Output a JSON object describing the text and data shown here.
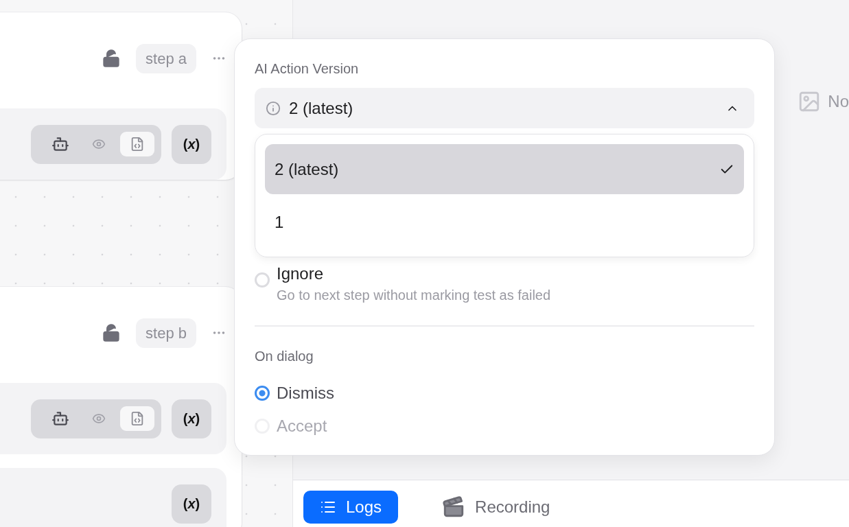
{
  "canvas": {
    "steps": [
      {
        "label": "step a",
        "locked": false,
        "panels": [
          {
            "tools": [
              {
                "kind": "robot",
                "selected": false
              },
              {
                "kind": "eye",
                "selected": false
              },
              {
                "kind": "code",
                "selected": true
              }
            ],
            "variables": "(*x*)"
          }
        ]
      },
      {
        "label": "step b",
        "locked": false,
        "panels": [
          {
            "tools": [
              {
                "kind": "robot",
                "selected": false
              },
              {
                "kind": "eye",
                "selected": false
              },
              {
                "kind": "code",
                "selected": true
              }
            ],
            "variables": "(*x*)"
          },
          {
            "variables": "(*x*)"
          }
        ]
      }
    ]
  },
  "popover": {
    "version_label": "AI Action Version",
    "select": {
      "value": "2 (latest)",
      "expanded": true,
      "options": [
        {
          "label": "2 (latest)",
          "selected": true
        },
        {
          "label": "1",
          "selected": false
        }
      ]
    },
    "failure_options": [
      {
        "label": "Ignore",
        "description": "Go to next step without marking test as failed",
        "selected": false
      }
    ],
    "dialog_label": "On dialog",
    "dialog_options": [
      {
        "label": "Dismiss",
        "selected": true
      },
      {
        "label": "Accept",
        "selected": false
      }
    ]
  },
  "preview": {
    "text": "No"
  },
  "bottom_tabs": [
    {
      "kind": "list",
      "label": "Logs",
      "selected": true
    },
    {
      "kind": "video",
      "label": "Recording",
      "selected": false
    }
  ]
}
